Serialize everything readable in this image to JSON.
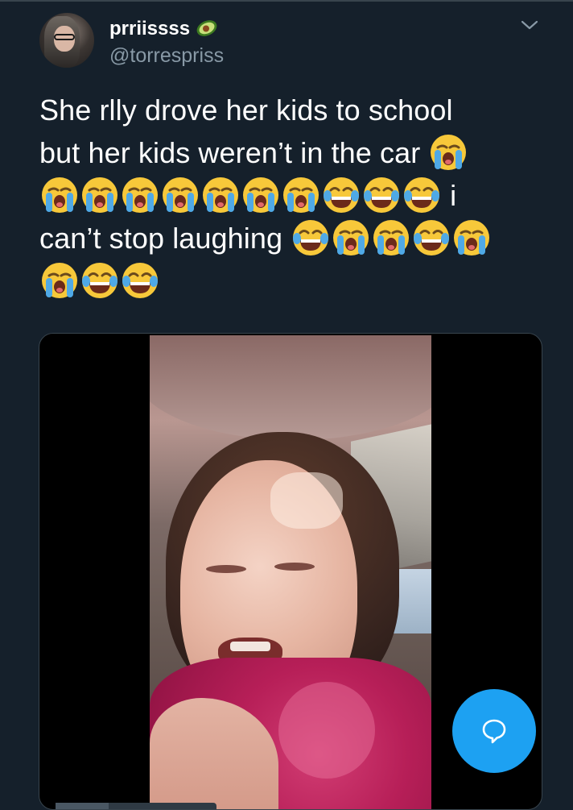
{
  "tweet": {
    "display_name": "prriissss",
    "handle": "@torrespriss",
    "text_lines": [
      "She rlly drove her kids to school",
      "but her kids weren’t in the car",
      "i",
      "can’t stop laughing"
    ],
    "line_emoji": {
      "line2": [
        "loudly-crying-face"
      ],
      "line3": [
        "loudly-crying-face",
        "loudly-crying-face",
        "loudly-crying-face",
        "loudly-crying-face",
        "loudly-crying-face",
        "loudly-crying-face",
        "loudly-crying-face",
        "face-with-tears-of-joy",
        "face-with-tears-of-joy",
        "face-with-tears-of-joy"
      ],
      "line4": [
        "face-with-tears-of-joy",
        "loudly-crying-face",
        "loudly-crying-face",
        "face-with-tears-of-joy",
        "loudly-crying-face"
      ],
      "line5": [
        "loudly-crying-face",
        "face-with-tears-of-joy",
        "face-with-tears-of-joy"
      ]
    },
    "video_progress": 0.33
  },
  "icons": {
    "badge": "avocado-icon",
    "menu": "chevron-down-icon",
    "compose": "reply-bubble-icon"
  },
  "colors": {
    "background": "#15202b",
    "secondary_text": "#8899a6",
    "accent": "#1da1f2"
  }
}
